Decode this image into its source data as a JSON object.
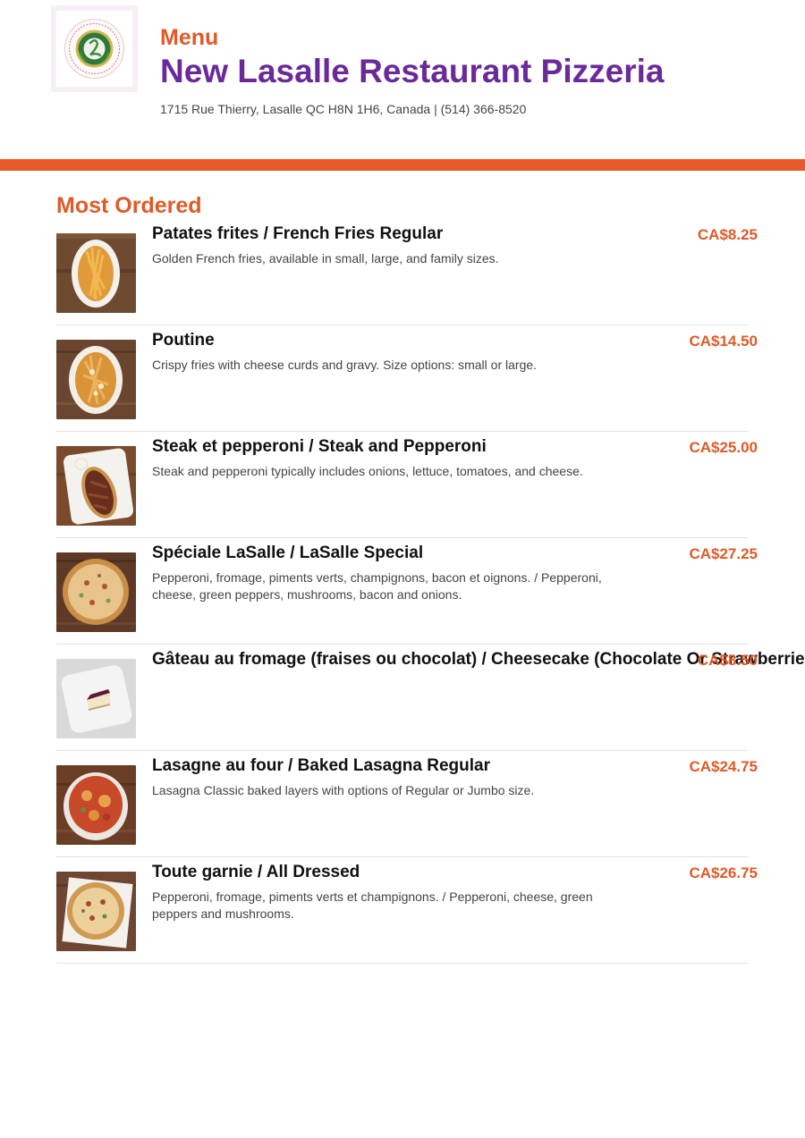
{
  "header": {
    "menu_label": "Menu",
    "restaurant_name": "New Lasalle Restaurant Pizzeria",
    "address": "1715 Rue Thierry, Lasalle QC H8N 1H6, Canada | (514) 366-8520",
    "logo_icon": "restaurant-logo-seal-icon"
  },
  "colors": {
    "accent_orange": "#e8592a",
    "title_purple": "#6a2a9a",
    "price_orange": "#e05a28"
  },
  "section": {
    "title": "Most Ordered"
  },
  "items": [
    {
      "name": "Patates frites / French Fries Regular",
      "description": "Golden French fries, available in small, large, and family sizes.",
      "price": "CA$8.25",
      "image_icon": "french-fries-photo"
    },
    {
      "name": "Poutine",
      "description": "Crispy fries with cheese curds and gravy. Size options: small or large.",
      "price": "CA$14.50",
      "image_icon": "poutine-photo"
    },
    {
      "name": "Steak et pepperoni / Steak and Pepperoni",
      "description": "Steak and pepperoni typically includes onions, lettuce, tomatoes, and cheese.",
      "price": "CA$25.00",
      "image_icon": "steak-sandwich-photo"
    },
    {
      "name": "Spéciale LaSalle / LaSalle Special",
      "description": "Pepperoni, fromage, piments verts, champignons, bacon et oignons. / Pepperoni, cheese, green peppers, mushrooms, bacon and onions.",
      "price": "CA$27.25",
      "image_icon": "pizza-photo"
    },
    {
      "name": "Gâteau au fromage (fraises ou chocolat) / Cheesecake (Chocolate Or Strawberries)",
      "description": "",
      "price": "CA$8.50",
      "image_icon": "cheesecake-photo"
    },
    {
      "name": "Lasagne au four / Baked Lasagna Regular",
      "description": "Lasagna Classic baked layers with options of Regular or Jumbo size.",
      "price": "CA$24.75",
      "image_icon": "lasagna-photo"
    },
    {
      "name": "Toute garnie / All Dressed",
      "description": "Pepperoni, fromage, piments verts et champignons. / Pepperoni, cheese, green peppers and mushrooms.",
      "price": "CA$26.75",
      "image_icon": "all-dressed-pizza-photo"
    }
  ]
}
